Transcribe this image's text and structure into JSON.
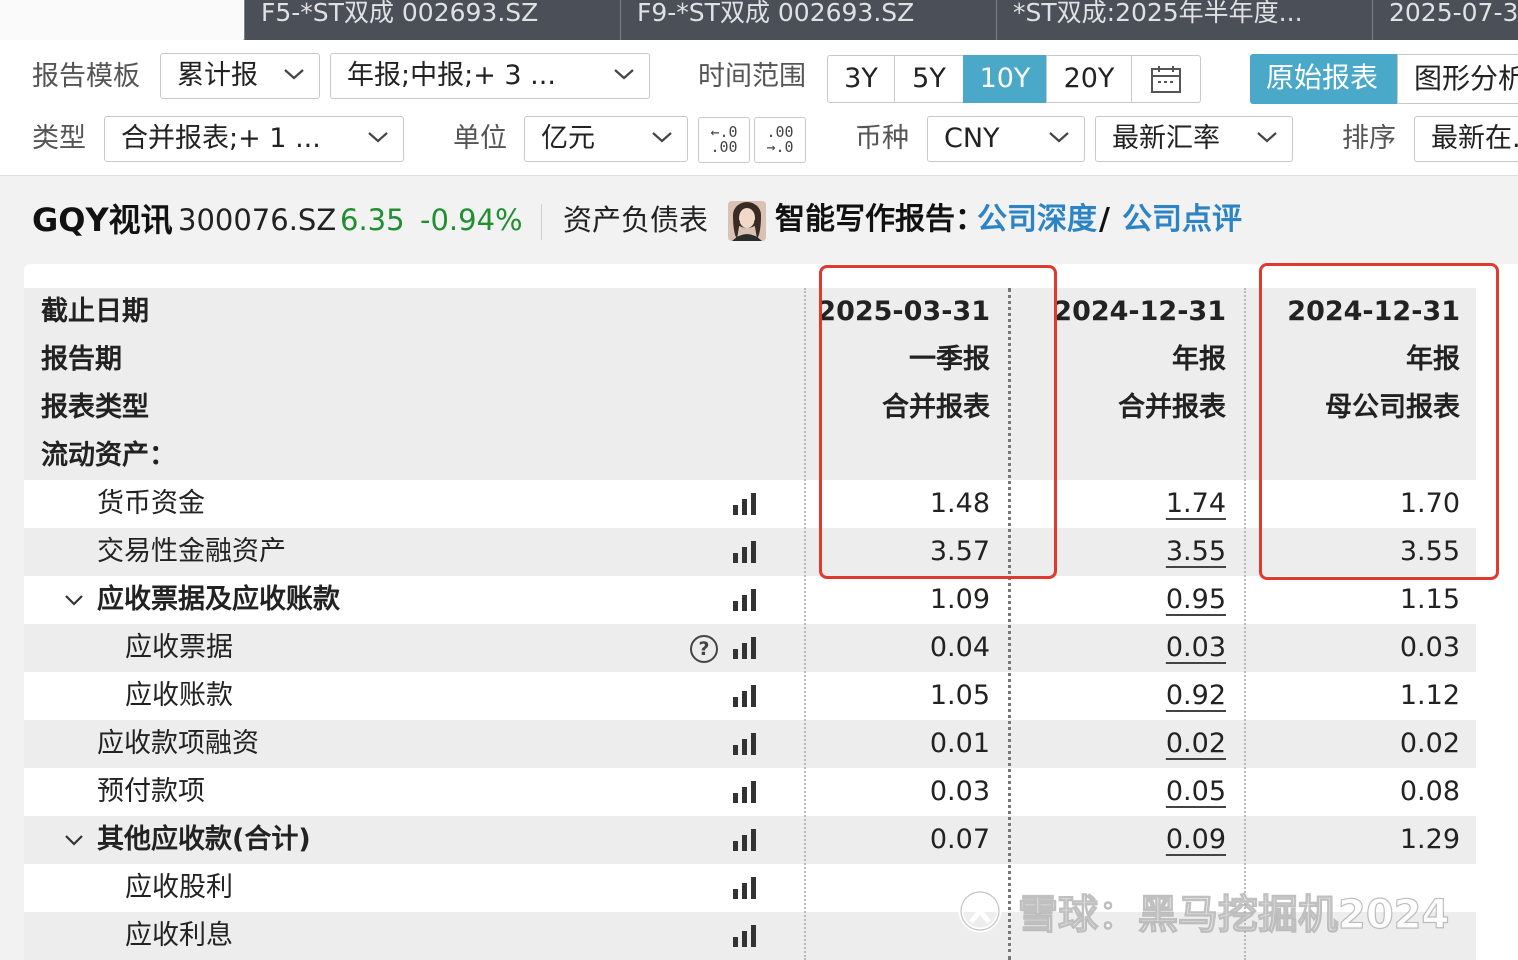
{
  "tabs": [
    {
      "label": "F5-*ST双成 002693.SZ"
    },
    {
      "label": "F9-*ST双成 002693.SZ"
    },
    {
      "label": "*ST双成:2025年半年度..."
    },
    {
      "label": "2025-07-3"
    }
  ],
  "toolbar": {
    "template_label": "报告模板",
    "template_value": "累计报",
    "period_value": "年报;中报;+ 3 ...",
    "time_label": "时间范围",
    "time_options": [
      "3Y",
      "5Y",
      "10Y",
      "20Y"
    ],
    "time_active": "10Y",
    "view_tabs": [
      "原始报表",
      "图形分析"
    ],
    "type_label": "类型",
    "type_value": "合并报表;+ 1 ...",
    "unit_label": "单位",
    "unit_value": "亿元",
    "dec_less": "←.0\n.00",
    "dec_more": ".00\n→.0",
    "currency_label": "币种",
    "currency_value": "CNY",
    "rate_value": "最新汇率",
    "sort_label": "排序",
    "sort_value": "最新在..."
  },
  "stock": {
    "name": "GQY视讯",
    "code": "300076.SZ",
    "price": "6.35",
    "change_pct": "-0.94%",
    "sheet": "资产负债表",
    "ai_label": "智能写作报告：",
    "ai_link1": "公司深度",
    "ai_slash": "/",
    "ai_link2": "公司点评",
    "price_color": "#1f8f2f"
  },
  "table": {
    "header_labels": [
      "截止日期",
      "报告期",
      "报表类型"
    ],
    "columns": [
      {
        "date": "2025-03-31",
        "period": "一季报",
        "type": "合并报表"
      },
      {
        "date": "2024-12-31",
        "period": "年报",
        "type": "合并报表"
      },
      {
        "date": "2024-12-31",
        "period": "年报",
        "type": "母公司报表"
      }
    ],
    "rows": [
      {
        "name": "流动资产：",
        "indent": 0,
        "bold": true,
        "values": [
          "",
          "",
          ""
        ]
      },
      {
        "name": "货币资金",
        "indent": 2,
        "bold": false,
        "values": [
          "1.48",
          "1.74",
          "1.70"
        ]
      },
      {
        "name": "交易性金融资产",
        "indent": 2,
        "bold": false,
        "values": [
          "3.57",
          "3.55",
          "3.55"
        ]
      },
      {
        "name": "应收票据及应收账款",
        "indent": 2,
        "bold": true,
        "expander": true,
        "values": [
          "1.09",
          "0.95",
          "1.15"
        ]
      },
      {
        "name": "应收票据",
        "indent": 3,
        "bold": false,
        "help": true,
        "values": [
          "0.04",
          "0.03",
          "0.03"
        ]
      },
      {
        "name": "应收账款",
        "indent": 3,
        "bold": false,
        "values": [
          "1.05",
          "0.92",
          "1.12"
        ]
      },
      {
        "name": "应收款项融资",
        "indent": 2,
        "bold": false,
        "values": [
          "0.01",
          "0.02",
          "0.02"
        ]
      },
      {
        "name": "预付款项",
        "indent": 2,
        "bold": false,
        "values": [
          "0.03",
          "0.05",
          "0.08"
        ]
      },
      {
        "name": "其他应收款(合计)",
        "indent": 2,
        "bold": true,
        "expander": true,
        "values": [
          "0.07",
          "0.09",
          "1.29"
        ]
      },
      {
        "name": "应收股利",
        "indent": 3,
        "bold": false,
        "values": [
          "",
          "",
          ""
        ]
      },
      {
        "name": "应收利息",
        "indent": 3,
        "bold": false,
        "values": [
          "",
          "",
          ""
        ]
      }
    ],
    "highlight_color": "#e0392d"
  },
  "watermark": {
    "text": "雪球：黑马挖掘机2024"
  }
}
